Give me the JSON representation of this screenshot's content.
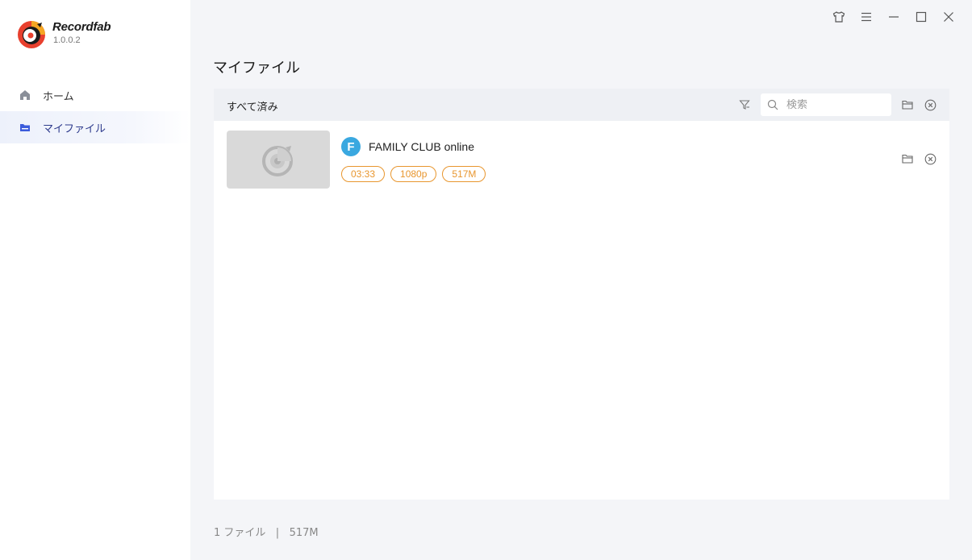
{
  "app": {
    "name": "Recordfab",
    "version": "1.0.0.2"
  },
  "sidebar": {
    "items": [
      {
        "label": "ホーム",
        "icon": "home-icon",
        "active": false
      },
      {
        "label": "マイファイル",
        "icon": "folder-icon",
        "active": true
      }
    ]
  },
  "window_controls": [
    "shirt-icon",
    "menu-icon",
    "minimize-icon",
    "maximize-icon",
    "close-icon"
  ],
  "main": {
    "title": "マイファイル",
    "toolbar": {
      "filter_label": "すべて済み",
      "search_placeholder": "検索"
    },
    "files": [
      {
        "title": "FAMILY CLUB online",
        "source_letter": "F",
        "duration": "03:33",
        "resolution": "1080p",
        "size": "517M"
      }
    ],
    "footer": {
      "status": "1 ファイル   |   517M"
    }
  },
  "colors": {
    "accent": "#e8962e",
    "sidebar_active_text": "#2d3a8c",
    "source_icon": "#3aa8e0"
  }
}
